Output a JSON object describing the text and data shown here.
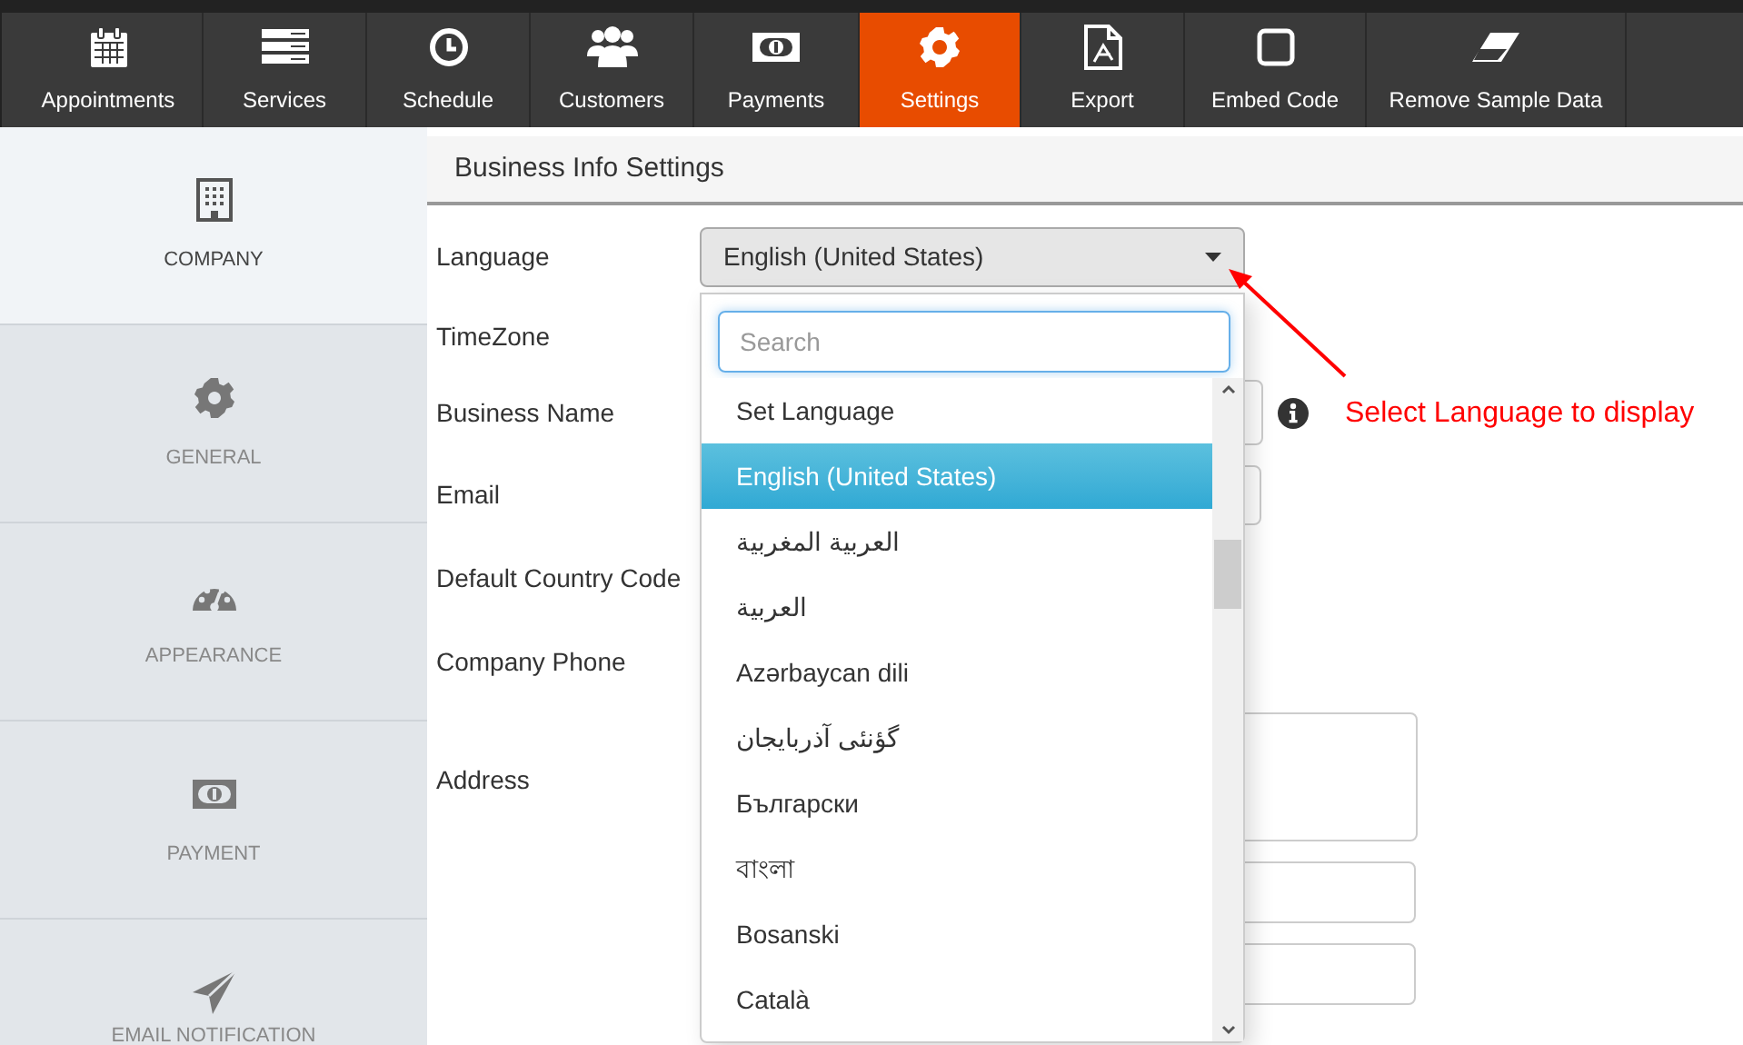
{
  "nav": [
    {
      "label": "Appointments",
      "selected": false
    },
    {
      "label": "Services",
      "selected": false
    },
    {
      "label": "Schedule",
      "selected": false
    },
    {
      "label": "Customers",
      "selected": false
    },
    {
      "label": "Payments",
      "selected": false
    },
    {
      "label": "Settings",
      "selected": true
    },
    {
      "label": "Export",
      "selected": false
    },
    {
      "label": "Embed Code",
      "selected": false
    },
    {
      "label": "Remove Sample Data",
      "selected": false
    }
  ],
  "sidebar": {
    "items": [
      {
        "label": "COMPANY",
        "selected": true
      },
      {
        "label": "GENERAL",
        "selected": false
      },
      {
        "label": "APPEARANCE",
        "selected": false
      },
      {
        "label": "PAYMENT",
        "selected": false
      },
      {
        "label": "EMAIL NOTIFICATION",
        "selected": false
      }
    ]
  },
  "panel": {
    "title": "Business Info Settings",
    "fields": [
      {
        "label": "Language",
        "kind": "select",
        "value": "English (United States)"
      },
      {
        "label": "TimeZone",
        "kind": "hidden"
      },
      {
        "label": "Business Name",
        "kind": "info"
      },
      {
        "label": "Email",
        "kind": "text"
      },
      {
        "label": "Default Country Code",
        "kind": "hidden"
      },
      {
        "label": "Company Phone",
        "kind": "hidden"
      },
      {
        "label": "Address",
        "kind": "address"
      }
    ]
  },
  "dropdown": {
    "search": {
      "placeholder": "Search"
    },
    "options": [
      {
        "label": "Set Language",
        "selected": false
      },
      {
        "label": "English (United States)",
        "selected": true
      },
      {
        "label": "العربية المغربية",
        "selected": false
      },
      {
        "label": "العربية",
        "selected": false
      },
      {
        "label": "Azərbaycan dili",
        "selected": false
      },
      {
        "label": "گؤنئی آذربایجان",
        "selected": false
      },
      {
        "label": "Български",
        "selected": false
      },
      {
        "label": "বাংলা",
        "selected": false
      },
      {
        "label": "Bosanski",
        "selected": false
      },
      {
        "label": "Català",
        "selected": false
      }
    ]
  },
  "annotation": {
    "text": "Select Language to display"
  }
}
